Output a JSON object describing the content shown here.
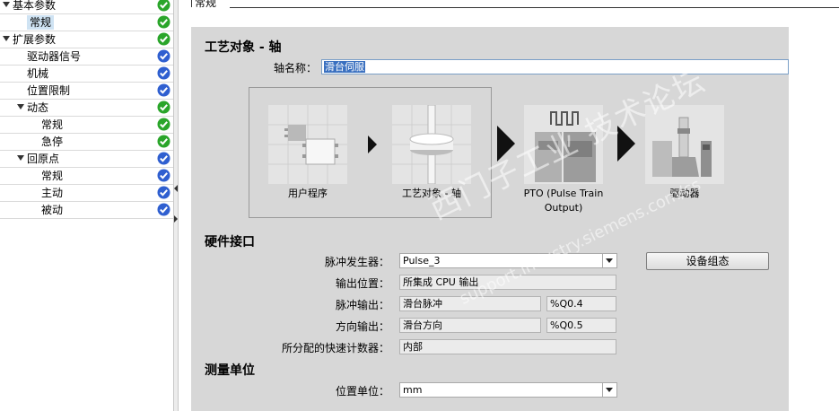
{
  "tree": {
    "items": [
      {
        "label": "基本参数",
        "level": 0,
        "expanded": true,
        "status": "green"
      },
      {
        "label": "常规",
        "level": 1,
        "selected": true,
        "status": "green"
      },
      {
        "label": "扩展参数",
        "level": 0,
        "expanded": true,
        "status": "green"
      },
      {
        "label": "驱动器信号",
        "level": 1,
        "status": "blue"
      },
      {
        "label": "机械",
        "level": 1,
        "status": "blue"
      },
      {
        "label": "位置限制",
        "level": 1,
        "status": "blue"
      },
      {
        "label": "动态",
        "level": 1,
        "expanded": true,
        "status": "green"
      },
      {
        "label": "常规",
        "level": 2,
        "status": "green"
      },
      {
        "label": "急停",
        "level": 2,
        "status": "green"
      },
      {
        "label": "回原点",
        "level": 1,
        "expanded": true,
        "status": "blue"
      },
      {
        "label": "常规",
        "level": 2,
        "status": "blue"
      },
      {
        "label": "主动",
        "level": 2,
        "status": "blue"
      },
      {
        "label": "被动",
        "level": 2,
        "status": "blue"
      }
    ]
  },
  "section_title": "常规",
  "tech_object": {
    "heading": "工艺对象 - 轴",
    "axis_name_label": "轴名称：",
    "axis_name_value": "滑台伺服"
  },
  "diagram": {
    "items": [
      {
        "caption": "用户程序"
      },
      {
        "caption": "工艺对象 - 轴"
      },
      {
        "caption": "PTO (Pulse Train\nOutput)"
      },
      {
        "caption": "驱动器"
      }
    ]
  },
  "hardware": {
    "heading": "硬件接口",
    "pulse_gen_label": "脉冲发生器：",
    "pulse_gen_value": "Pulse_3",
    "output_loc_label": "输出位置：",
    "output_loc_value": "所集成 CPU 输出",
    "pulse_out_label": "脉冲输出：",
    "pulse_out_value": "滑台脉冲",
    "pulse_out_addr": "%Q0.4",
    "dir_out_label": "方向输出：",
    "dir_out_value": "滑台方向",
    "dir_out_addr": "%Q0.5",
    "counter_label": "所分配的快速计数器：",
    "counter_value": "内部",
    "config_button": "设备组态"
  },
  "units": {
    "heading": "测量单位",
    "pos_unit_label": "位置单位：",
    "pos_unit_value": "mm"
  },
  "watermark": {
    "line1": "西门子工业 技术论坛",
    "line2": "support.industry.siemens.com/cs"
  },
  "colors": {
    "status_green": "#2aa52a",
    "status_blue": "#2f5fd0",
    "panel_bg": "#d7d7d7",
    "selection": "#3a70c0"
  }
}
